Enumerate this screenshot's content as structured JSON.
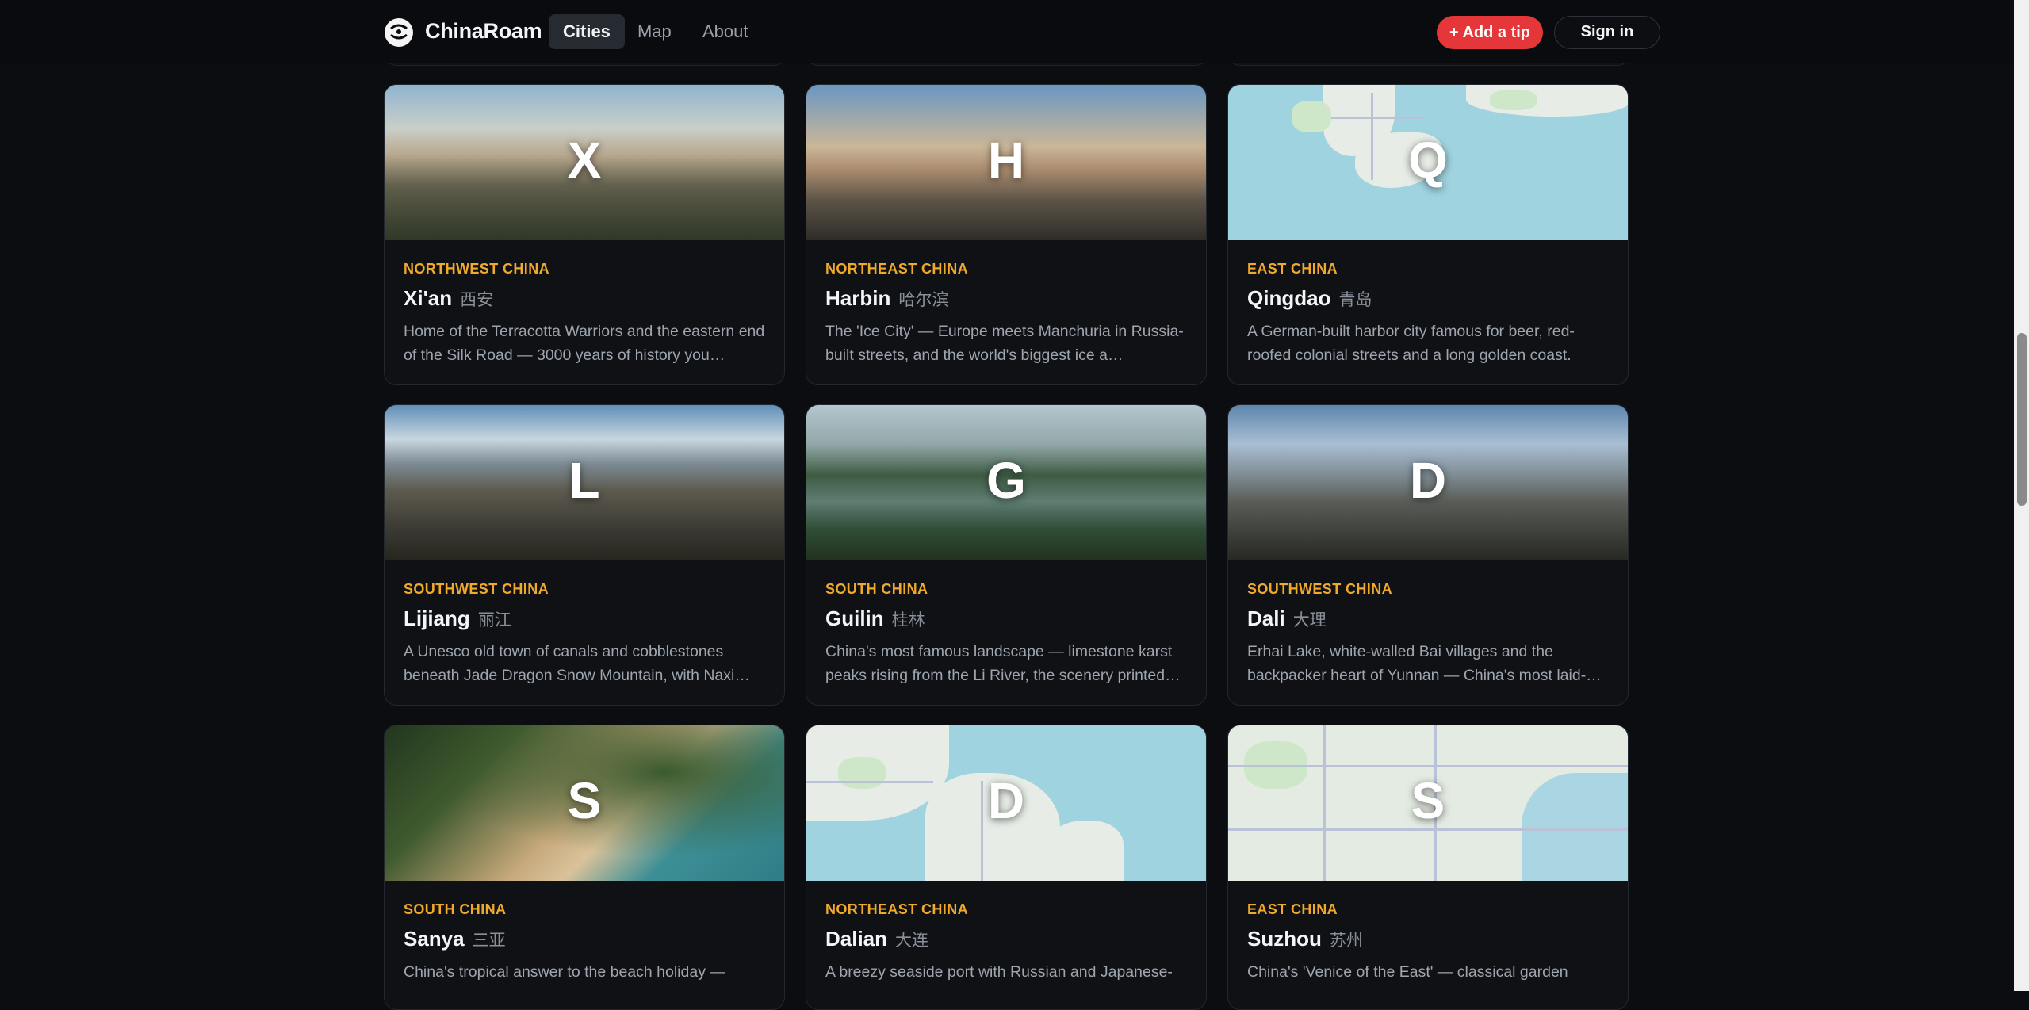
{
  "header": {
    "brand": "ChinaRoam",
    "nav": [
      {
        "label": "Cities",
        "active": true
      },
      {
        "label": "Map",
        "active": false
      },
      {
        "label": "About",
        "active": false
      }
    ],
    "add_tip_label": "+ Add a tip",
    "sign_in_label": "Sign in"
  },
  "colors": {
    "accent_red": "#e5373a",
    "region_gold": "#f0a92a",
    "background": "#0b0d11"
  },
  "cities": [
    {
      "letter": "X",
      "region": "NORTHWEST CHINA",
      "name": "Xi'an",
      "name_cn": "西安",
      "description": "Home of the Terracotta Warriors and the eastern end of the Silk Road — 3000 years of history you…"
    },
    {
      "letter": "H",
      "region": "NORTHEAST CHINA",
      "name": "Harbin",
      "name_cn": "哈尔滨",
      "description": "The 'Ice City' — Europe meets Manchuria in Russia-built streets, and the world's biggest ice a…"
    },
    {
      "letter": "Q",
      "region": "EAST CHINA",
      "name": "Qingdao",
      "name_cn": "青岛",
      "description": "A German-built harbor city famous for beer, red-roofed colonial streets and a long golden coast."
    },
    {
      "letter": "L",
      "region": "SOUTHWEST CHINA",
      "name": "Lijiang",
      "name_cn": "丽江",
      "description": "A Unesco old town of canals and cobblestones beneath Jade Dragon Snow Mountain, with Naxi…"
    },
    {
      "letter": "G",
      "region": "SOUTH CHINA",
      "name": "Guilin",
      "name_cn": "桂林",
      "description": "China's most famous landscape — limestone karst peaks rising from the Li River, the scenery printed…"
    },
    {
      "letter": "D",
      "region": "SOUTHWEST CHINA",
      "name": "Dali",
      "name_cn": "大理",
      "description": "Erhai Lake, white-walled Bai villages and the backpacker heart of Yunnan — China's most laid-…"
    },
    {
      "letter": "S",
      "region": "SOUTH CHINA",
      "name": "Sanya",
      "name_cn": "三亚",
      "description": "China's tropical answer to the beach holiday —"
    },
    {
      "letter": "D",
      "region": "NORTHEAST CHINA",
      "name": "Dalian",
      "name_cn": "大连",
      "description": "A breezy seaside port with Russian and Japanese-"
    },
    {
      "letter": "S",
      "region": "EAST CHINA",
      "name": "Suzhou",
      "name_cn": "苏州",
      "description": "China's 'Venice of the East' — classical garden"
    }
  ]
}
